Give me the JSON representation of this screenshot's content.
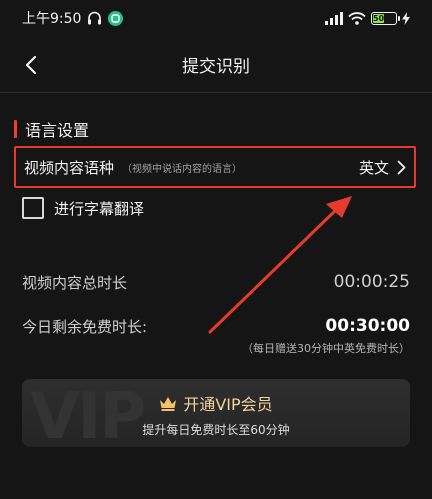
{
  "status_bar": {
    "time": "上午9:50",
    "battery_level": "50",
    "battery_fraction": 0.5
  },
  "header": {
    "title": "提交识别"
  },
  "section": {
    "title": "语言设置"
  },
  "language_row": {
    "label": "视频内容语种",
    "hint": "（视频中说话内容的语言）",
    "value": "英文"
  },
  "translate": {
    "label": "进行字幕翻译",
    "checked": false
  },
  "video_duration": {
    "label": "视频内容总时长",
    "value": "00:00:25"
  },
  "free_time": {
    "label": "今日剩余免费时长:",
    "value": "00:30:00",
    "note": "（每日赠送30分钟中英免费时长）"
  },
  "vip": {
    "watermark": "VIP",
    "title": "开通VIP会员",
    "subtitle": "提升每日免费时长至60分钟"
  },
  "colors": {
    "background": "#151515",
    "highlight_border": "#e53b2f",
    "section_accent": "#e9412c",
    "vip_gold": "#f3d39a"
  },
  "icons": [
    "headset-icon",
    "app-badge-icon",
    "signal-icon",
    "wifi-icon",
    "battery-icon",
    "bolt-icon",
    "back-arrow-icon",
    "chevron-right-icon",
    "crown-icon"
  ]
}
